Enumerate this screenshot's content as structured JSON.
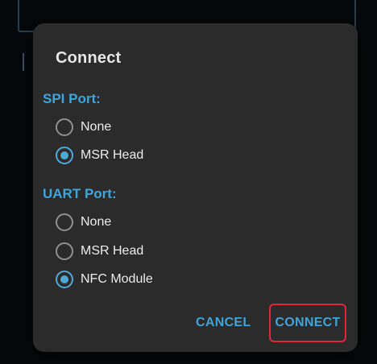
{
  "dialog": {
    "title": "Connect",
    "spi_section": {
      "label": "SPI Port:",
      "options": [
        {
          "label": "None",
          "checked": false
        },
        {
          "label": "MSR Head",
          "checked": true
        }
      ]
    },
    "uart_section": {
      "label": "UART Port:",
      "options": [
        {
          "label": "None",
          "checked": false
        },
        {
          "label": "MSR Head",
          "checked": false
        },
        {
          "label": "NFC Module",
          "checked": true
        }
      ]
    },
    "buttons": {
      "cancel_label": "CANCEL",
      "connect_label": "CONNECT"
    }
  },
  "colors": {
    "accent": "#3ea4d9",
    "dialog_bg": "#2b2b2b",
    "highlight": "#e0263a"
  }
}
